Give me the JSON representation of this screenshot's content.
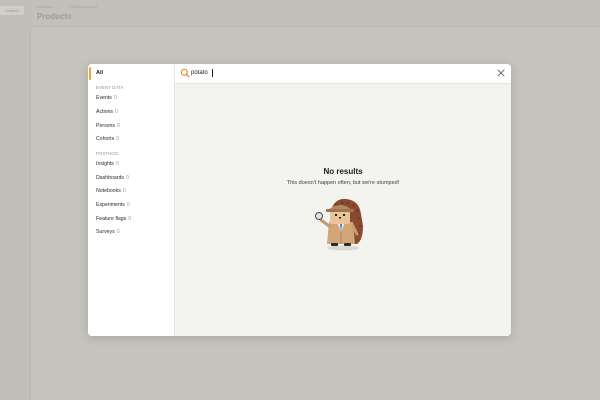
{
  "background": {
    "nav_button": "Untitled",
    "breadcrumb_1": "Analytics",
    "breadcrumb_2": "Untitled project",
    "page_title": "Products"
  },
  "modal": {
    "search": {
      "value": "potato",
      "placeholder": ""
    },
    "sidebar": {
      "all_label": "All",
      "section_event_data": "EVENT DATA",
      "section_posthog": "POSTHOG",
      "event_data_items": [
        {
          "label": "Events",
          "count": "0"
        },
        {
          "label": "Actions",
          "count": "0"
        },
        {
          "label": "Persons",
          "count": "0"
        },
        {
          "label": "Cohorts",
          "count": "0"
        }
      ],
      "posthog_items": [
        {
          "label": "Insights",
          "count": "0"
        },
        {
          "label": "Dashboards",
          "count": "0"
        },
        {
          "label": "Notebooks",
          "count": "0"
        },
        {
          "label": "Experiments",
          "count": "0"
        },
        {
          "label": "Feature flags",
          "count": "0"
        },
        {
          "label": "Surveys",
          "count": "0"
        }
      ]
    },
    "empty_state": {
      "title": "No results",
      "subtitle": "This doesn't happen often, but we're stumped!",
      "illustration": "detective-hedgehog"
    }
  },
  "colors": {
    "accent": "#f1a82c",
    "search_icon": "#e07a1f",
    "panel_bg": "#f3f3ef",
    "backdrop": "#d3d3cd"
  },
  "icons": [
    "search-icon",
    "close-icon"
  ]
}
